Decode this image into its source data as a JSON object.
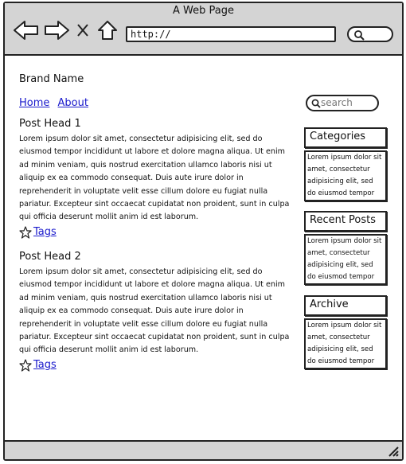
{
  "window": {
    "title": "A Web Page"
  },
  "browser": {
    "url": "http://",
    "icons": [
      "back-arrow-icon",
      "forward-arrow-icon",
      "close-icon",
      "home-icon",
      "search-icon"
    ]
  },
  "site": {
    "brand": "Brand Name",
    "nav": [
      {
        "label": "Home"
      },
      {
        "label": "About"
      }
    ],
    "search_placeholder": "search"
  },
  "posts": [
    {
      "head": "Post Head 1",
      "body": "Lorem ipsum dolor sit amet, consectetur adipisicing elit, sed do eiusmod tempor incididunt ut labore et dolore magna aliqua. Ut enim ad minim veniam, quis nostrud exercitation ullamco laboris nisi ut aliquip ex ea commodo consequat. Duis aute irure dolor in reprehenderit in voluptate velit esse cillum dolore eu fugiat nulla pariatur. Excepteur sint occaecat cupidatat non proident, sunt in culpa qui officia deserunt mollit anim id est laborum.",
      "tags_label": "Tags"
    },
    {
      "head": "Post Head 2",
      "body": "Lorem ipsum dolor sit amet, consectetur adipisicing elit, sed do eiusmod tempor incididunt ut labore et dolore magna aliqua. Ut enim ad minim veniam, quis nostrud exercitation ullamco laboris nisi ut aliquip ex ea commodo consequat. Duis aute irure dolor in reprehenderit in voluptate velit esse cillum dolore eu fugiat nulla pariatur. Excepteur sint occaecat cupidatat non proident, sunt in culpa qui officia deserunt mollit anim id est laborum.",
      "tags_label": "Tags"
    }
  ],
  "sidebar": [
    {
      "title": "Categories",
      "text": "Lorem ipsum dolor sit amet, consectetur adipisicing elit, sed do eiusmod tempor"
    },
    {
      "title": "Recent Posts",
      "text": "Lorem ipsum dolor sit amet, consectetur adipisicing elit, sed do eiusmod tempor"
    },
    {
      "title": "Archive",
      "text": "Lorem ipsum dolor sit amet, consectetur adipisicing elit, sed do eiusmod tempor"
    }
  ],
  "colors": {
    "chrome": "#d4d4d4",
    "link": "#1a1acc",
    "border": "#222222"
  }
}
